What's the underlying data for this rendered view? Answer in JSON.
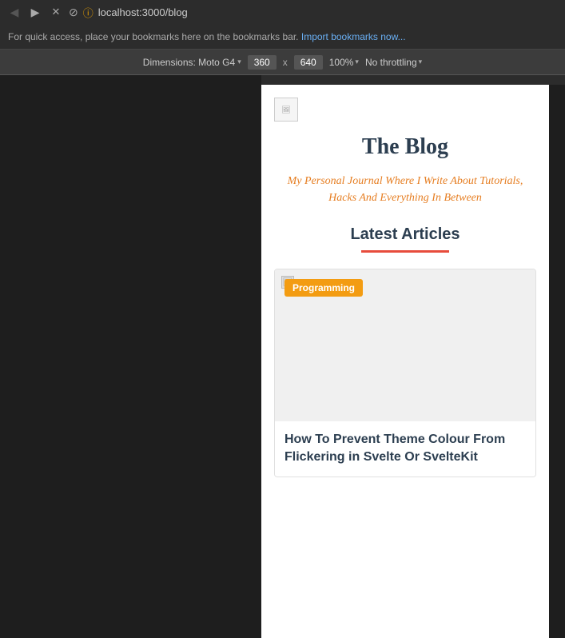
{
  "browser": {
    "url": "localhost:3000/blog",
    "bookmarks_bar_text": "For quick access, place your bookmarks here on the bookmarks bar.",
    "bookmarks_import_link": "Import bookmarks now...",
    "device": {
      "label": "Dimensions: Moto G4",
      "width": "360",
      "height": "640",
      "zoom": "100%",
      "throttling": "No throttling"
    }
  },
  "blog": {
    "title": "The Blog",
    "tagline": "My Personal Journal Where I Write About Tutorials, Hacks And Everything In Between",
    "section_title": "Latest Articles",
    "article": {
      "badge": "Programming",
      "title": "How To Prevent Theme Colour From Flickering in Svelte Or SvelteKit"
    }
  },
  "icons": {
    "back": "◀",
    "forward": "▶",
    "close": "✕",
    "bookmark": "⊘",
    "security": "ⓘ",
    "chevron": "▾"
  }
}
